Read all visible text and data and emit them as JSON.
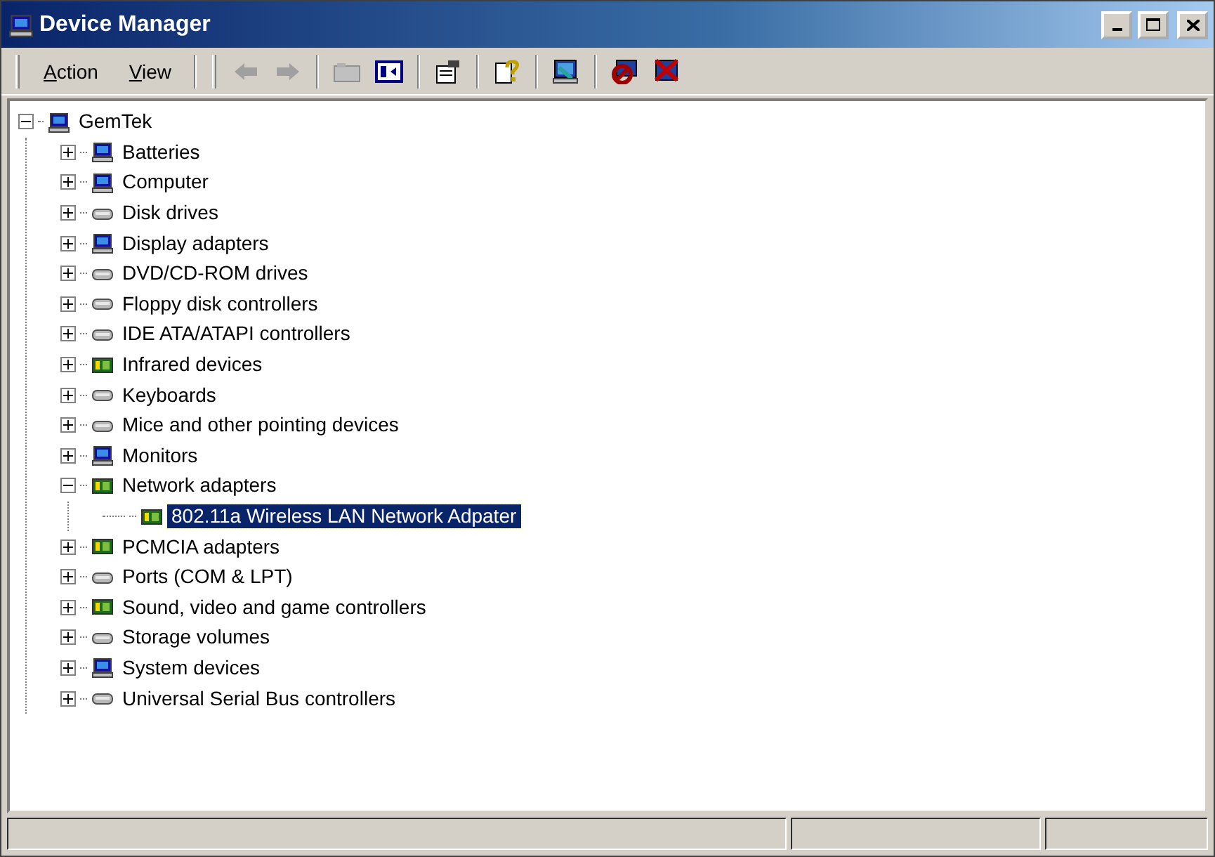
{
  "window": {
    "title": "Device Manager"
  },
  "menu": [
    {
      "label": "Action"
    },
    {
      "label": "View"
    }
  ],
  "toolbar_buttons": [
    {
      "kind": "back",
      "disabled": true
    },
    {
      "kind": "forward",
      "disabled": true
    },
    {
      "kind": "sep"
    },
    {
      "kind": "up",
      "disabled": true
    },
    {
      "kind": "tree"
    },
    {
      "kind": "sep"
    },
    {
      "kind": "properties"
    },
    {
      "kind": "sep"
    },
    {
      "kind": "help"
    },
    {
      "kind": "sep"
    },
    {
      "kind": "scan"
    },
    {
      "kind": "sep"
    },
    {
      "kind": "disable"
    },
    {
      "kind": "uninstall"
    }
  ],
  "tree": [
    {
      "label": "GemTek",
      "expanded": true,
      "selected": false,
      "children": [
        {
          "label": "Batteries",
          "expanded": false,
          "selected": false
        },
        {
          "label": "Computer",
          "expanded": false,
          "selected": false
        },
        {
          "label": "Disk drives",
          "expanded": false,
          "selected": false
        },
        {
          "label": "Display adapters",
          "expanded": false,
          "selected": false
        },
        {
          "label": "DVD/CD-ROM drives",
          "expanded": false,
          "selected": false
        },
        {
          "label": "Floppy disk controllers",
          "expanded": false,
          "selected": false
        },
        {
          "label": "IDE ATA/ATAPI controllers",
          "expanded": false,
          "selected": false
        },
        {
          "label": "Infrared devices",
          "expanded": false,
          "selected": false
        },
        {
          "label": "Keyboards",
          "expanded": false,
          "selected": false
        },
        {
          "label": "Mice and other pointing devices",
          "expanded": false,
          "selected": false
        },
        {
          "label": "Monitors",
          "expanded": false,
          "selected": false
        },
        {
          "label": "Network adapters",
          "expanded": true,
          "selected": false,
          "children": [
            {
              "label": "802.11a Wireless LAN Network Adpater",
              "selected": true
            }
          ]
        },
        {
          "label": "PCMCIA adapters",
          "expanded": false,
          "selected": false
        },
        {
          "label": "Ports (COM & LPT)",
          "expanded": false,
          "selected": false
        },
        {
          "label": "Sound, video and game controllers",
          "expanded": false,
          "selected": false
        },
        {
          "label": "Storage volumes",
          "expanded": false,
          "selected": false
        },
        {
          "label": "System devices",
          "expanded": false,
          "selected": false
        },
        {
          "label": "Universal Serial Bus controllers",
          "expanded": false,
          "selected": false
        }
      ]
    }
  ]
}
